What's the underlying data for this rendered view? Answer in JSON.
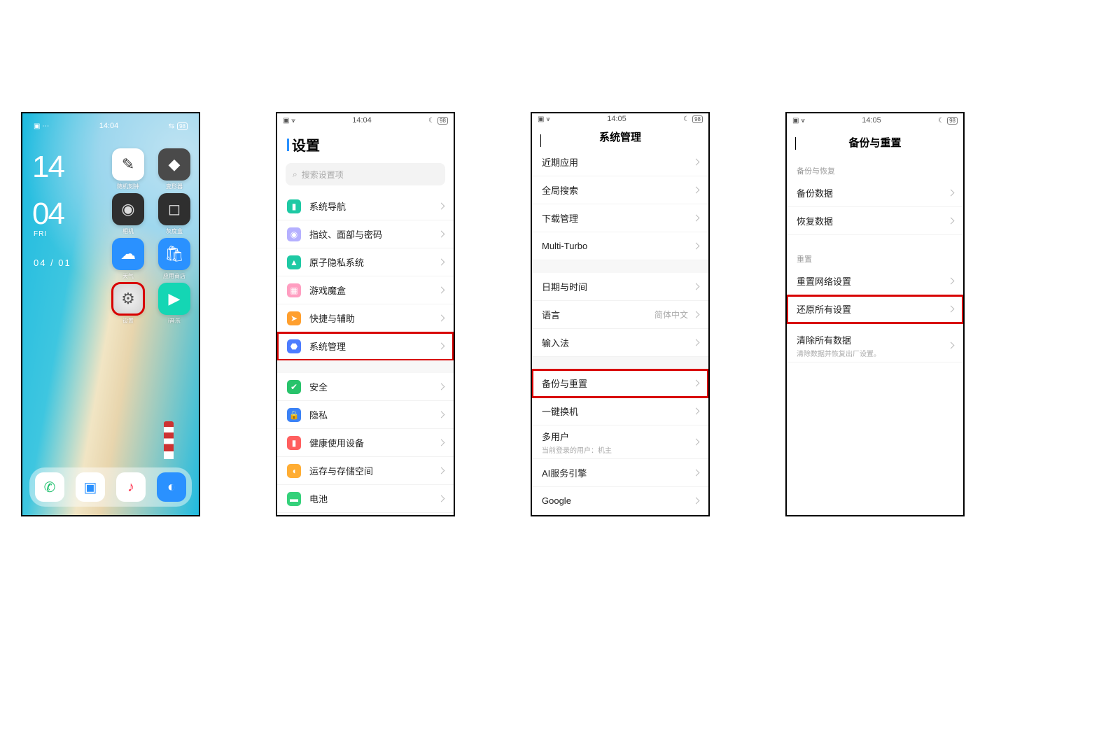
{
  "statusbar": {
    "time1": "14:04",
    "time2": "14:04",
    "time3": "14:05",
    "time4": "14:05",
    "batt": "98"
  },
  "home": {
    "clock_top": "14",
    "clock_bot": "04",
    "day": "FRI",
    "date": "04 / 01",
    "apps": {
      "a1": "随机刻钟",
      "a2": "变形器",
      "a3": "相机",
      "a4": "灰度盒",
      "a5": "天气",
      "a6": "应用商店",
      "a7": "设置",
      "a8": "i音乐"
    }
  },
  "settings": {
    "title": "设置",
    "search_ph": "搜索设置项",
    "items": {
      "nav": "系统导航",
      "finger": "指纹、面部与密码",
      "atom": "原子隐私系统",
      "game": "游戏魔盒",
      "quick": "快捷与辅助",
      "system": "系统管理",
      "safe": "安全",
      "privacy": "隐私",
      "health": "健康使用设备",
      "storage": "运存与存储空间",
      "battery": "电池"
    }
  },
  "sysmgr": {
    "title": "系统管理",
    "items": {
      "recent": "近期应用",
      "global": "全局搜索",
      "download": "下载管理",
      "multiturbo": "Multi-Turbo",
      "datetime": "日期与时间",
      "language": "语言",
      "language_val": "简体中文",
      "input": "输入法",
      "backup": "备份与重置",
      "clone": "一键换机",
      "multiuser": "多用户",
      "multiuser_sub": "当前登录的用户：机主",
      "aiengine": "AI服务引擎",
      "google": "Google"
    }
  },
  "backup": {
    "title": "备份与重置",
    "sect_backup": "备份与恢复",
    "sect_reset": "重置",
    "items": {
      "backup_data": "备份数据",
      "restore_data": "恢复数据",
      "reset_net": "重置网络设置",
      "reset_all": "还原所有设置",
      "wipe": "清除所有数据",
      "wipe_sub": "清除数据并恢复出厂设置。"
    }
  }
}
